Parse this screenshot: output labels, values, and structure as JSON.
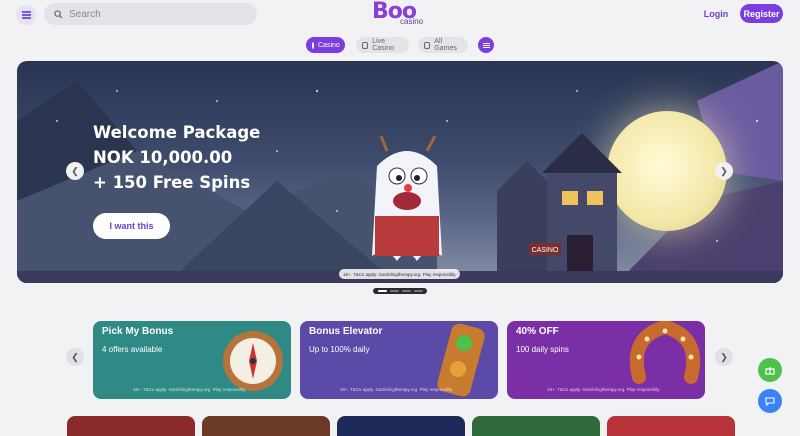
{
  "header": {
    "search_placeholder": "Search",
    "logo_text": "Boo",
    "logo_sub": "casino",
    "login_label": "Login",
    "register_label": "Register"
  },
  "categories": [
    {
      "label": "Casino",
      "active": true
    },
    {
      "label": "Live Casino",
      "active": false
    },
    {
      "label": "All Games",
      "active": false
    }
  ],
  "hero": {
    "line1": "Welcome Package",
    "line2": "NOK 10,000.00",
    "line3": "+ 150 Free Spins",
    "cta_label": "I want this",
    "disclaimer": "18+. T&Cs apply. Gamblingtherapy.org. Play responsibly.",
    "sign_text": "CASINO",
    "slide_count": 4,
    "active_slide": 0
  },
  "promos": [
    {
      "title": "Pick My Bonus",
      "subtitle": "4 offers available",
      "disclaimer": "18+. T&Cs apply. Gamblingtherapy.org. Play responsibly.",
      "color": "#2f8a86"
    },
    {
      "title": "Bonus Elevator",
      "subtitle": "Up to 100% daily",
      "disclaimer": "18+. T&Cs apply. Gamblingtherapy.org. Play responsibly.",
      "color": "#5b4aa8"
    },
    {
      "title": "40% OFF",
      "subtitle": "100 daily spins",
      "disclaimer": "18+. T&Cs apply. Gamblingtherapy.org. Play responsibly.",
      "color": "#7a2fa6"
    }
  ],
  "colors": {
    "accent": "#7a3ee0",
    "chat_green": "#4cc24a",
    "chat_blue": "#3b82f6"
  },
  "icons": {
    "menu": "hamburger-icon",
    "search": "search-icon",
    "prev": "chevron-left-icon",
    "next": "chevron-right-icon",
    "gift": "gift-icon",
    "chat": "chat-icon",
    "filter": "filter-icon"
  }
}
